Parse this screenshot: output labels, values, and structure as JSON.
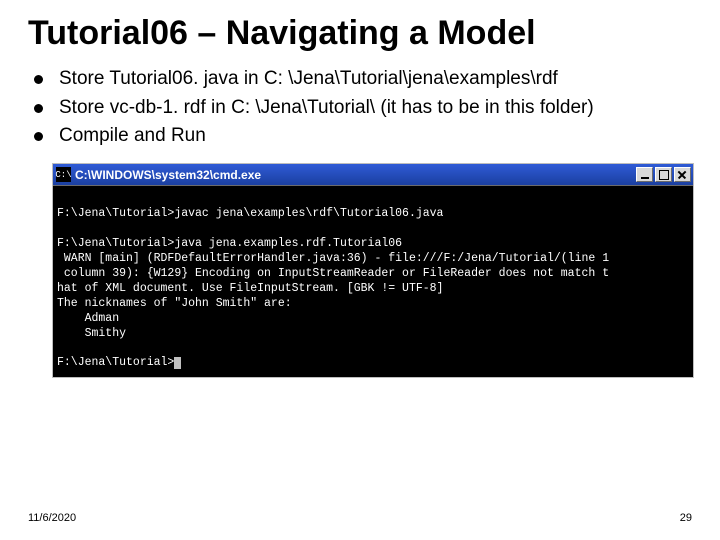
{
  "title": "Tutorial06 – Navigating a Model",
  "bullets": [
    "Store Tutorial06. java in C: \\Jena\\Tutorial\\jena\\examples\\rdf",
    "Store vc-db-1. rdf in C: \\Jena\\Tutorial\\ (it has to be in this folder)",
    "Compile and Run"
  ],
  "terminal": {
    "icon_text": "C:\\",
    "title": "C:\\WINDOWS\\system32\\cmd.exe",
    "lines": [
      "",
      "F:\\Jena\\Tutorial>javac jena\\examples\\rdf\\Tutorial06.java",
      "",
      "F:\\Jena\\Tutorial>java jena.examples.rdf.Tutorial06",
      " WARN [main] (RDFDefaultErrorHandler.java:36) - file:///F:/Jena/Tutorial/(line 1",
      " column 39): {W129} Encoding on InputStreamReader or FileReader does not match t",
      "hat of XML document. Use FileInputStream. [GBK != UTF-8]",
      "The nicknames of \"John Smith\" are:",
      "    Adman",
      "    Smithy",
      "",
      "F:\\Jena\\Tutorial>"
    ]
  },
  "footer": {
    "date": "11/6/2020",
    "page": "29"
  }
}
